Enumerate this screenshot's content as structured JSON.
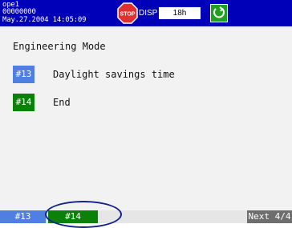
{
  "status_bar": {
    "id": "ope1",
    "batch": "00000000",
    "datetime": "May.27.2004 14:05:09",
    "stop_icon": "stop-icon",
    "stop_text": "STOP",
    "disp_label": "DISP",
    "interval": "18h",
    "memory_icon": "memory-status-icon",
    "colors": {
      "background": "#0000b8",
      "stop": "#e03030",
      "memory": "#1fa01f"
    }
  },
  "main": {
    "title": "Engineering Mode",
    "items": [
      {
        "num": "#13",
        "label": "Daylight savings time",
        "color": "#4f7fe0"
      },
      {
        "num": "#14",
        "label": "End",
        "color": "#0a820a"
      }
    ]
  },
  "softkeys": {
    "key1": "#13",
    "key2": "#14",
    "next": "Next 4/4"
  }
}
